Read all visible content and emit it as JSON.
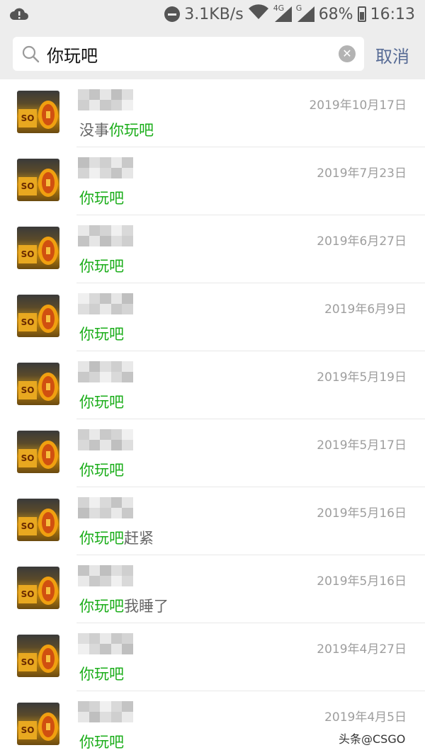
{
  "status_bar": {
    "net_speed": "3.1KB/s",
    "network_4g": "4G",
    "network_g": "G",
    "battery": "68%",
    "time": "16:13"
  },
  "search": {
    "query": "你玩吧",
    "cancel_label": "取消",
    "highlight_color": "#1aad19"
  },
  "results": [
    {
      "date": "2019年10月17日",
      "prefix": "没事",
      "match": "你玩吧",
      "suffix": ""
    },
    {
      "date": "2019年7月23日",
      "prefix": "",
      "match": "你玩吧",
      "suffix": ""
    },
    {
      "date": "2019年6月27日",
      "prefix": "",
      "match": "你玩吧",
      "suffix": ""
    },
    {
      "date": "2019年6月9日",
      "prefix": "",
      "match": "你玩吧",
      "suffix": ""
    },
    {
      "date": "2019年5月19日",
      "prefix": "",
      "match": "你玩吧",
      "suffix": ""
    },
    {
      "date": "2019年5月17日",
      "prefix": "",
      "match": "你玩吧",
      "suffix": ""
    },
    {
      "date": "2019年5月16日",
      "prefix": "",
      "match": "你玩吧",
      "suffix": "赶紧"
    },
    {
      "date": "2019年5月16日",
      "prefix": "",
      "match": "你玩吧",
      "suffix": "我睡了"
    },
    {
      "date": "2019年4月27日",
      "prefix": "",
      "match": "你玩吧",
      "suffix": ""
    },
    {
      "date": "2019年4月5日",
      "prefix": "",
      "match": "你玩吧",
      "suffix": ""
    }
  ],
  "watermark": "头条@CSGO"
}
